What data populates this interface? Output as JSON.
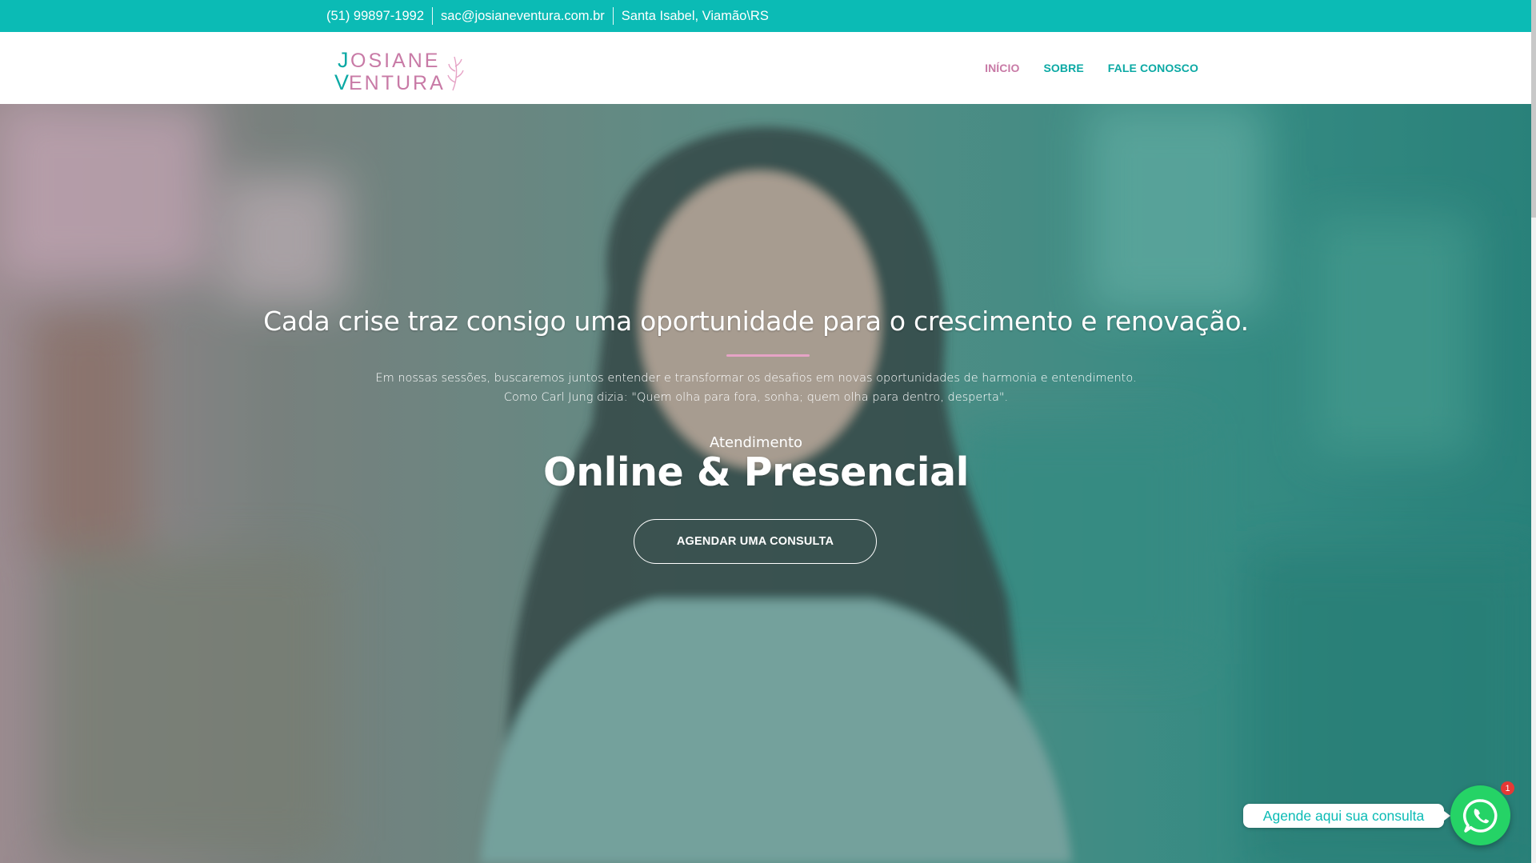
{
  "topbar": {
    "phone": "(51) 99897-1992",
    "email": "sac@josianeventura.com.br",
    "location": "Santa Isabel, Viamão\\RS"
  },
  "logo": {
    "line1": "OSIANE",
    "line2": "ENTURA",
    "initial1": "J",
    "initial2": "V"
  },
  "nav": {
    "items": [
      {
        "label": "INÍCIO",
        "active": true
      },
      {
        "label": "SOBRE",
        "active": false
      },
      {
        "label": "FALE CONOSCO",
        "active": false
      }
    ]
  },
  "hero": {
    "headline": "Cada crise traz consigo uma oportunidade para o crescimento e renovação.",
    "paragraph_line1": "Em nossas sessões, buscaremos juntos entender e transformar os desafios em novas oportunidades de harmonia e entendimento.",
    "paragraph_line2": "Como Carl Jung dizia: \"Quem olha para fora, sonha; quem olha para dentro, desperta\".",
    "subtitle": "Atendimento",
    "title": "Online & Presencial",
    "cta_label": "AGENDAR UMA CONSULTA"
  },
  "whatsapp": {
    "label": "Agende aqui sua consulta",
    "badge": "1",
    "icon": "whatsapp-icon"
  },
  "colors": {
    "teal": "#0bbbb5",
    "pink": "#c87aa6",
    "whatsapp": "#25d366"
  }
}
